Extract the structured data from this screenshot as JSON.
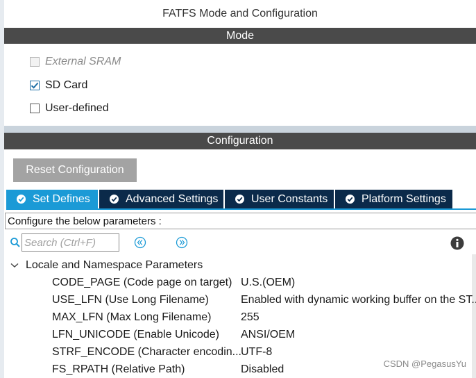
{
  "title": "FATFS Mode and Configuration",
  "mode": {
    "header": "Mode",
    "options": [
      {
        "label": "External SRAM",
        "checked": false,
        "disabled": true
      },
      {
        "label": "SD Card",
        "checked": true,
        "disabled": false
      },
      {
        "label": "User-defined",
        "checked": false,
        "disabled": false
      }
    ]
  },
  "configuration": {
    "header": "Configuration",
    "reset_label": "Reset Configuration",
    "tabs": [
      {
        "label": "Set Defines",
        "active": true
      },
      {
        "label": "Advanced Settings",
        "active": false
      },
      {
        "label": "User Constants",
        "active": false
      },
      {
        "label": "Platform Settings",
        "active": false
      }
    ],
    "hint": "Configure the below parameters :",
    "search": {
      "placeholder": "Search (Ctrl+F)",
      "value": ""
    },
    "group": {
      "label": "Locale and Namespace Parameters",
      "params": [
        {
          "name": "CODE_PAGE (Code page on target)",
          "value": "U.S.(OEM)"
        },
        {
          "name": "USE_LFN (Use Long Filename)",
          "value": "Enabled with dynamic working buffer on the ST.."
        },
        {
          "name": "MAX_LFN (Max Long Filename)",
          "value": "255"
        },
        {
          "name": "LFN_UNICODE (Enable Unicode)",
          "value": "ANSI/OEM"
        },
        {
          "name": "STRF_ENCODE (Character encodin...",
          "value": "UTF-8"
        },
        {
          "name": "FS_RPATH (Relative Path)",
          "value": "Disabled"
        }
      ]
    }
  },
  "icons": {
    "tab_icon": "check-circle-icon",
    "search": "search-icon",
    "prev": "chevron-left-circle-icon",
    "next": "chevron-right-circle-icon",
    "info": "info-icon",
    "expand": "chevron-down-icon"
  },
  "colors": {
    "header_bar": "#4a4a4a",
    "tab_active": "#1b9ad6",
    "tab_inactive": "#0b2a4a",
    "reset_button": "#a3a3a3",
    "checkbox_check": "#1d6fa5"
  },
  "watermark": "CSDN @PegasusYu"
}
